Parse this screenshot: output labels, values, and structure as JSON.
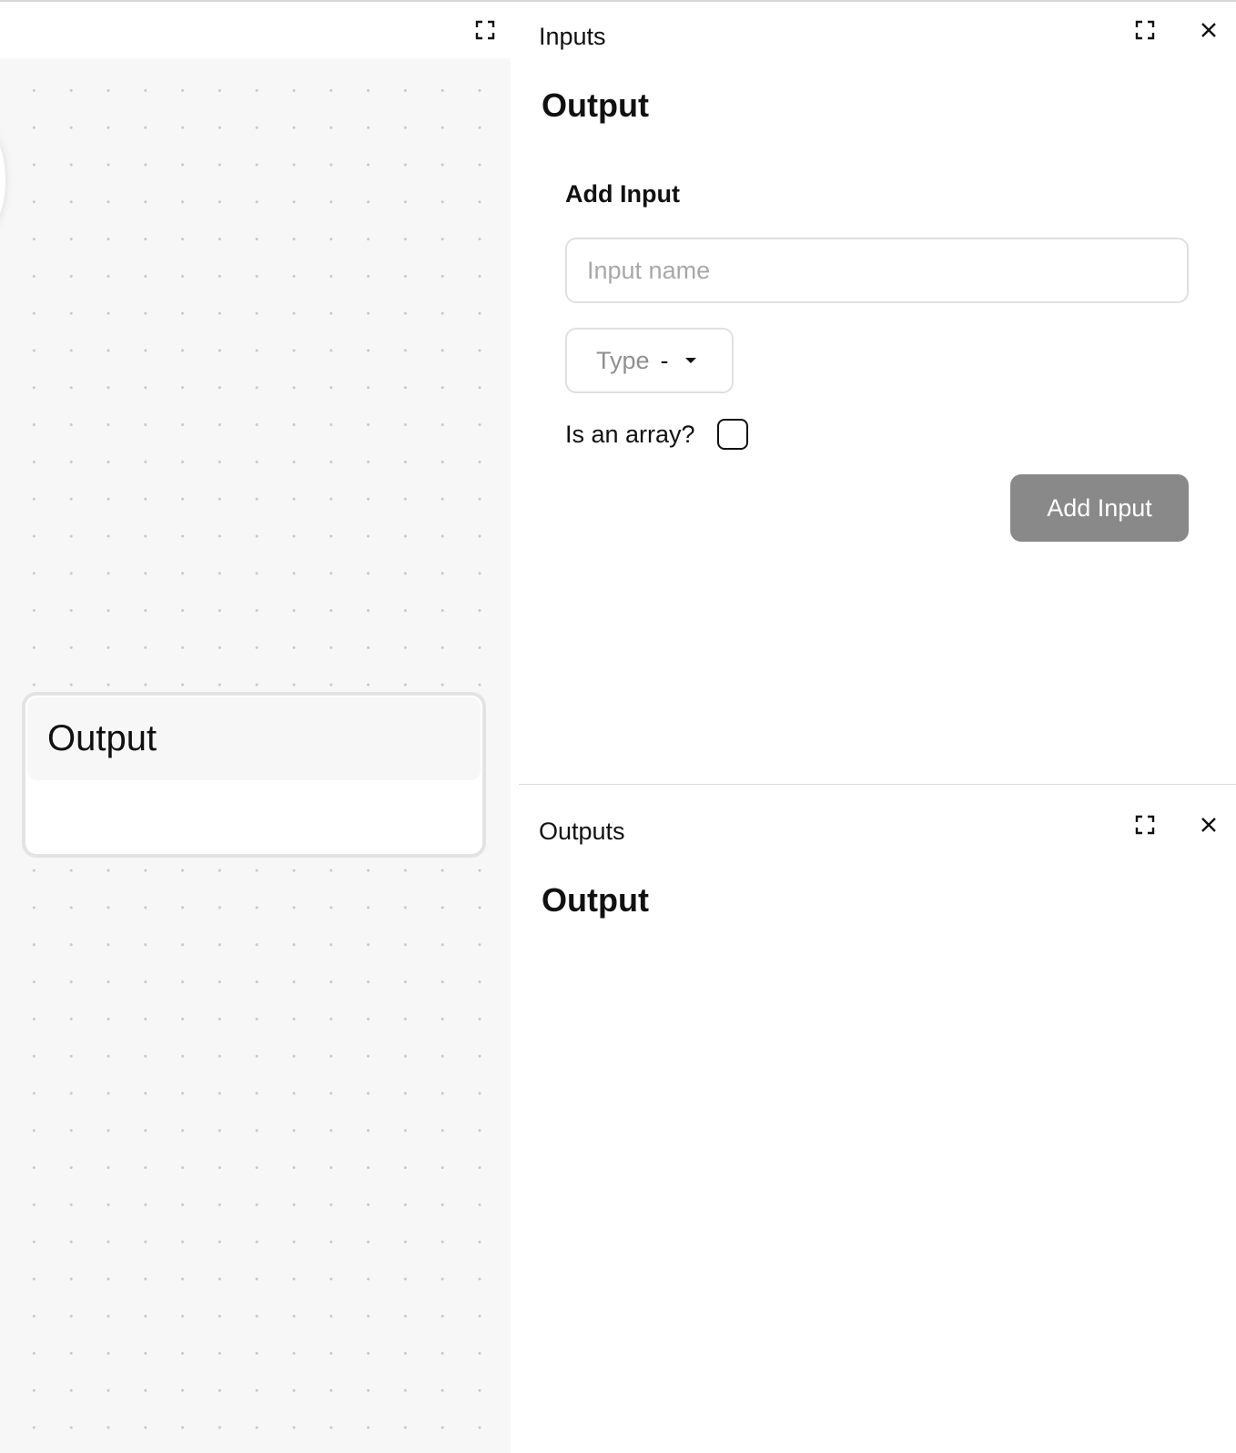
{
  "canvas": {
    "expand_icon": "expand-icon",
    "node": {
      "title": "Output"
    }
  },
  "inputs_panel": {
    "title": "Inputs",
    "heading": "Output",
    "expand_icon": "expand-icon",
    "close_icon": "close-icon",
    "form": {
      "section_label": "Add Input",
      "name_placeholder": "Input name",
      "name_value": "",
      "type_label": "Type",
      "type_value": "-",
      "array_label": "Is an array?",
      "array_checked": false,
      "submit_label": "Add Input"
    }
  },
  "outputs_panel": {
    "title": "Outputs",
    "heading": "Output",
    "expand_icon": "expand-icon",
    "close_icon": "close-icon"
  },
  "colors": {
    "canvas_background": "#f7f7f7",
    "grid_dot": "#c9c9c9",
    "button_background": "#898989",
    "border": "#e0e0e0"
  }
}
